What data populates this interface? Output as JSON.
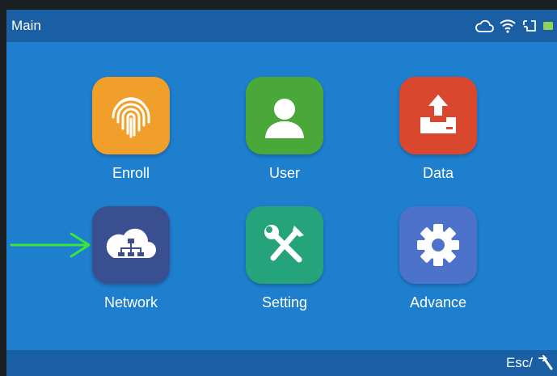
{
  "header": {
    "title": "Main"
  },
  "status_icons": [
    "cloud-icon",
    "wifi-icon",
    "usb-icon",
    "battery-icon"
  ],
  "apps": [
    {
      "label": "Enroll",
      "icon": "fingerprint-icon",
      "color": "#f0a02a"
    },
    {
      "label": "User",
      "icon": "user-icon",
      "color": "#4aa83a"
    },
    {
      "label": "Data",
      "icon": "data-icon",
      "color": "#d9472f"
    },
    {
      "label": "Network",
      "icon": "network-icon",
      "color": "#3a4f8f"
    },
    {
      "label": "Setting",
      "icon": "setting-icon",
      "color": "#25a37a"
    },
    {
      "label": "Advance",
      "icon": "gear-icon",
      "color": "#4d72c9"
    }
  ],
  "footer": {
    "esc_label": "Esc/"
  },
  "colors": {
    "screen_bg": "#1e7fcf",
    "bar_bg": "#1a5fa3",
    "pointer_arrow": "#39e63a"
  }
}
